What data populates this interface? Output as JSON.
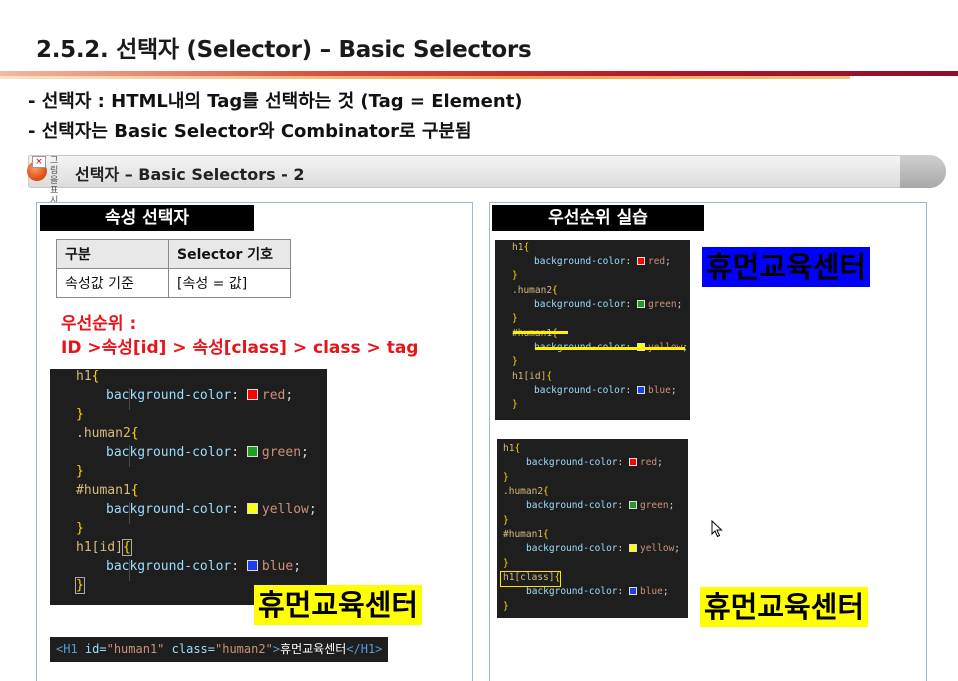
{
  "slide": {
    "title": "2.5.2. 선택자 (Selector) – Basic Selectors",
    "bullets": [
      "- 선택자 : HTML내의 Tag를 선택하는 것 (Tag = Element)",
      "- 선택자는 Basic Selector와 Combinator로 구분됨"
    ],
    "section_title": "선택자 – Basic Selectors - 2",
    "vertical_text": "그림을표시할수없습니다"
  },
  "left_panel": {
    "label": "속성 선택자",
    "table": {
      "headers": [
        "구분",
        "Selector 기호"
      ],
      "rows": [
        [
          "속성값 기준",
          "[속성 = 값]"
        ]
      ]
    },
    "priority_title": "우선순위 :",
    "priority_order": "ID >속성[id] > 속성[class] > class > tag",
    "code": [
      {
        "selector": "h1",
        "prop": "background-color",
        "color_name": "red",
        "swatch": "#ff0000"
      },
      {
        "selector": ".human2",
        "prop": "background-color",
        "color_name": "green",
        "swatch": "#1f9d1f"
      },
      {
        "selector": "#human1",
        "prop": "background-color",
        "color_name": "yellow",
        "swatch": "#ffff00"
      },
      {
        "selector": "h1[id]",
        "prop": "background-color",
        "color_name": "blue",
        "swatch": "#1d3df0"
      }
    ],
    "result_text": "휴먼교육센터",
    "html_line": {
      "open_tag": "<H1",
      "id_attr": "id=",
      "id_val": "\"human1\"",
      "class_attr": "class=",
      "class_val": "\"human2\"",
      "gt": ">",
      "text": "휴먼교육센터",
      "close_tag": "</H1>"
    }
  },
  "right_panel": {
    "label": "우선순위 실습",
    "code_top": [
      {
        "selector": "h1",
        "prop": "background-color",
        "color_name": "red",
        "swatch": "#ff0000"
      },
      {
        "selector": ".human2",
        "prop": "background-color",
        "color_name": "green",
        "swatch": "#1f9d1f"
      },
      {
        "selector": "#human1",
        "prop": "background-color",
        "color_name": "yellow",
        "swatch": "#ffff00"
      },
      {
        "selector": "h1[id]",
        "prop": "background-color",
        "color_name": "blue",
        "swatch": "#1d3df0"
      }
    ],
    "result_top": "휴먼교육센터",
    "code_bottom": [
      {
        "selector": "h1",
        "prop": "background-color",
        "color_name": "red",
        "swatch": "#ff0000"
      },
      {
        "selector": ".human2",
        "prop": "background-color",
        "color_name": "green",
        "swatch": "#1f9d1f"
      },
      {
        "selector": "#human1",
        "prop": "background-color",
        "color_name": "yellow",
        "swatch": "#ffff00"
      },
      {
        "selector": "h1[class]",
        "prop": "background-color",
        "color_name": "blue",
        "swatch": "#1d3df0"
      }
    ],
    "result_bottom": "휴먼교육센터"
  },
  "colors": {
    "accent_red": "#e8141b",
    "highlight_yellow": "#ffff00",
    "highlight_blue": "#0000ff",
    "panel_border": "#9fb7d3"
  },
  "icons": [
    "broken-image-icon",
    "section-bullet-icon",
    "mouse-pointer-icon"
  ]
}
